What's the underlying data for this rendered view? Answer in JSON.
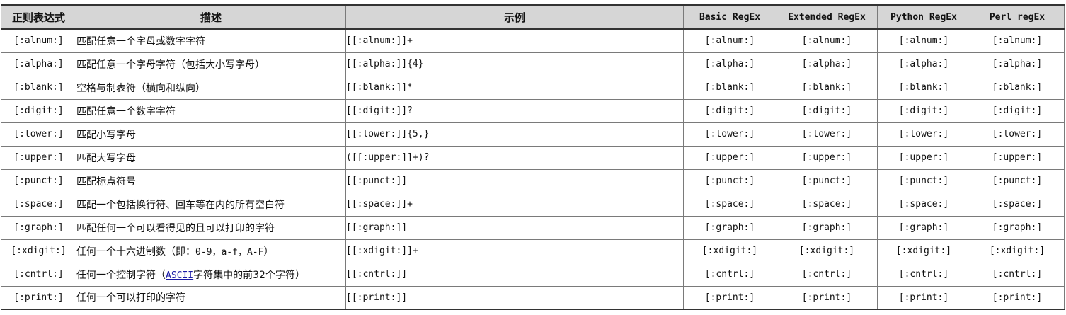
{
  "header": {
    "col_regex": "正则表达式",
    "col_desc": "描述",
    "col_example": "示例",
    "col_basic": "Basic RegEx",
    "col_extended": "Extended RegEx",
    "col_python": "Python RegEx",
    "col_perl": "Perl regEx"
  },
  "rows": [
    {
      "regex": "[:alnum:]",
      "desc": "匹配任意一个字母或数字字符",
      "example": "[[:alnum:]]+",
      "basic": "[:alnum:]",
      "extended": "[:alnum:]",
      "python": "[:alnum:]",
      "perl": "[:alnum:]"
    },
    {
      "regex": "[:alpha:]",
      "desc": "匹配任意一个字母字符（包括大小写字母）",
      "example": "[[:alpha:]]{4}",
      "basic": "[:alpha:]",
      "extended": "[:alpha:]",
      "python": "[:alpha:]",
      "perl": "[:alpha:]"
    },
    {
      "regex": "[:blank:]",
      "desc": "空格与制表符（横向和纵向）",
      "example": "[[:blank:]]*",
      "basic": "[:blank:]",
      "extended": "[:blank:]",
      "python": "[:blank:]",
      "perl": "[:blank:]"
    },
    {
      "regex": "[:digit:]",
      "desc": "匹配任意一个数字字符",
      "example": "[[:digit:]]?",
      "basic": "[:digit:]",
      "extended": "[:digit:]",
      "python": "[:digit:]",
      "perl": "[:digit:]"
    },
    {
      "regex": "[:lower:]",
      "desc": "匹配小写字母",
      "example": "[[:lower:]]{5,}",
      "basic": "[:lower:]",
      "extended": "[:lower:]",
      "python": "[:lower:]",
      "perl": "[:lower:]"
    },
    {
      "regex": "[:upper:]",
      "desc": "匹配大写字母",
      "example": "([[:upper:]]+)?",
      "basic": "[:upper:]",
      "extended": "[:upper:]",
      "python": "[:upper:]",
      "perl": "[:upper:]"
    },
    {
      "regex": "[:punct:]",
      "desc": "匹配标点符号",
      "example": "[[:punct:]]",
      "basic": "[:punct:]",
      "extended": "[:punct:]",
      "python": "[:punct:]",
      "perl": "[:punct:]"
    },
    {
      "regex": "[:space:]",
      "desc": "匹配一个包括换行符、回车等在内的所有空白符",
      "example": "[[:space:]]+",
      "basic": "[:space:]",
      "extended": "[:space:]",
      "python": "[:space:]",
      "perl": "[:space:]"
    },
    {
      "regex": "[:graph:]",
      "desc": "匹配任何一个可以看得见的且可以打印的字符",
      "example": "[[:graph:]]",
      "basic": "[:graph:]",
      "extended": "[:graph:]",
      "python": "[:graph:]",
      "perl": "[:graph:]"
    },
    {
      "regex": "[:xdigit:]",
      "desc_prefix": "任何一个十六进制数（即：",
      "desc_codes": "0-9，a-f，A-F",
      "desc_suffix": "）",
      "example": "[[:xdigit:]]+",
      "basic": "[:xdigit:]",
      "extended": "[:xdigit:]",
      "python": "[:xdigit:]",
      "perl": "[:xdigit:]"
    },
    {
      "regex": "[:cntrl:]",
      "desc_prefix": "任何一个控制字符（",
      "desc_link": "ASCII",
      "desc_suffix": "字符集中的前32个字符）",
      "example": "[[:cntrl:]]",
      "basic": "[:cntrl:]",
      "extended": "[:cntrl:]",
      "python": "[:cntrl:]",
      "perl": "[:cntrl:]"
    },
    {
      "regex": "[:print:]",
      "desc": "任何一个可以打印的字符",
      "example": "[[:print:]]",
      "basic": "[:print:]",
      "extended": "[:print:]",
      "python": "[:print:]",
      "perl": "[:print:]"
    }
  ]
}
